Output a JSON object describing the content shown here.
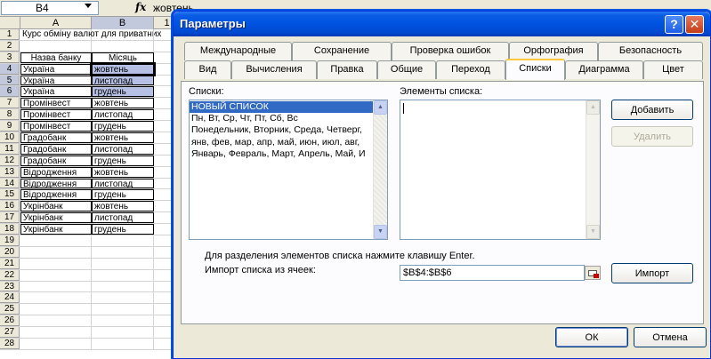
{
  "excel": {
    "name_box": "B4",
    "fx": "fx",
    "formula_value": "жовтень",
    "columns": [
      "A",
      "B"
    ],
    "col_c_partial": "1",
    "rows": [
      {
        "n": "1",
        "a": "Курс обміну валют для приватних",
        "b": ""
      },
      {
        "n": "2",
        "a": "",
        "b": ""
      },
      {
        "n": "3",
        "a": "Назва банку",
        "b": "Місяць"
      },
      {
        "n": "4",
        "a": "Україна",
        "b": "жовтень"
      },
      {
        "n": "5",
        "a": "Україна",
        "b": "листопад"
      },
      {
        "n": "6",
        "a": "Україна",
        "b": "грудень"
      },
      {
        "n": "7",
        "a": "Промінвест",
        "b": "жовтень"
      },
      {
        "n": "8",
        "a": "Промінвест",
        "b": "листопад"
      },
      {
        "n": "9",
        "a": "Промінвест",
        "b": "грудень"
      },
      {
        "n": "10",
        "a": "Градобанк",
        "b": "жовтень"
      },
      {
        "n": "11",
        "a": "Градобанк",
        "b": "листопад"
      },
      {
        "n": "12",
        "a": "Градобанк",
        "b": "грудень"
      },
      {
        "n": "13",
        "a": "Відродження",
        "b": "жовтень"
      },
      {
        "n": "14",
        "a": "Відродження",
        "b": "листопад"
      },
      {
        "n": "15",
        "a": "Відродження",
        "b": "грудень"
      },
      {
        "n": "16",
        "a": "Укрінбанк",
        "b": "жовтень"
      },
      {
        "n": "17",
        "a": "Укрінбанк",
        "b": "листопад"
      },
      {
        "n": "18",
        "a": "Укрінбанк",
        "b": "грудень"
      },
      {
        "n": "19",
        "a": "",
        "b": ""
      },
      {
        "n": "20",
        "a": "",
        "b": ""
      },
      {
        "n": "21",
        "a": "",
        "b": ""
      },
      {
        "n": "22",
        "a": "",
        "b": ""
      },
      {
        "n": "23",
        "a": "",
        "b": ""
      },
      {
        "n": "24",
        "a": "",
        "b": ""
      },
      {
        "n": "25",
        "a": "",
        "b": ""
      },
      {
        "n": "26",
        "a": "",
        "b": ""
      },
      {
        "n": "27",
        "a": "",
        "b": ""
      },
      {
        "n": "28",
        "a": "",
        "b": ""
      }
    ]
  },
  "dialog": {
    "title": "Параметры",
    "help_label": "?",
    "close_label": "✕",
    "tabs_row1": [
      "Международные",
      "Сохранение",
      "Проверка ошибок",
      "Орфография",
      "Безопасность"
    ],
    "tabs_row2": [
      "Вид",
      "Вычисления",
      "Правка",
      "Общие",
      "Переход",
      "Списки",
      "Диаграмма",
      "Цвет"
    ],
    "lists_label": "Списки:",
    "lists": [
      "НОВЫЙ СПИСОК",
      "Пн, Вт, Ср, Чт, Пт, Сб, Вс",
      "Понедельник, Вторник, Среда, Четверг,",
      "янв, фев, мар, апр, май, июн, июл, авг,",
      "Январь, Февраль, Март, Апрель, Май, И"
    ],
    "elements_label": "Элементы списка:",
    "add_button": "Добавить",
    "delete_button": "Удалить",
    "hint": "Для разделения элементов списка нажмите клавишу Enter.",
    "import_label": "Импорт списка из ячеек:",
    "import_value": "$B$4:$B$6",
    "import_button": "Импорт",
    "ok_button": "ОК",
    "cancel_button": "Отмена"
  }
}
